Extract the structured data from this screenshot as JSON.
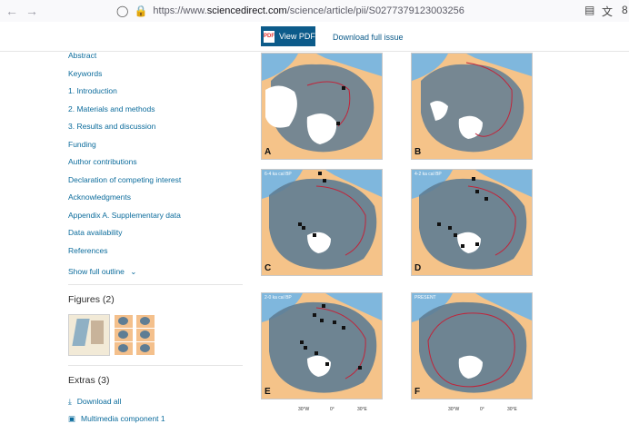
{
  "browser": {
    "url_prefix": "https://www.",
    "url_domain": "sciencedirect.com",
    "url_path": "/science/article/pii/S0277379123003256",
    "right_clip": "8"
  },
  "toolbar": {
    "view_pdf": "View PDF",
    "pdf_icon_text": "PDF",
    "download_issue": "Download full issue"
  },
  "outline": {
    "items": [
      "Abstract",
      "Keywords",
      "1. Introduction",
      "2. Materials and methods",
      "3. Results and discussion",
      "Funding",
      "Author contributions",
      "Declaration of competing interest",
      "Acknowledgments",
      "Appendix A. Supplementary data",
      "Data availability",
      "References"
    ],
    "show_full": "Show full outline"
  },
  "figures": {
    "title": "Figures (2)"
  },
  "extras": {
    "title": "Extras (3)",
    "download_all": "Download all",
    "multimedia": "Multimedia component 1"
  },
  "panels": {
    "a": {
      "letter": "A",
      "era": ""
    },
    "b": {
      "letter": "B",
      "era": ""
    },
    "c": {
      "letter": "C",
      "era": "6-4 ka cal BP"
    },
    "d": {
      "letter": "D",
      "era": "4-2 ka cal BP"
    },
    "e": {
      "letter": "E",
      "era": "2-0 ka cal BP"
    },
    "f": {
      "letter": "F",
      "era": "PRESENT"
    }
  },
  "axis_labels": {
    "w30": "30°W",
    "zero": "0°",
    "e30": "30°E"
  },
  "colors": {
    "land": "#f5c389",
    "ocean": "#7fb7dd",
    "shelf": "#5f7d94",
    "ice": "#ffffff",
    "line": "#c0243a",
    "accent": "#0c5b8a"
  }
}
